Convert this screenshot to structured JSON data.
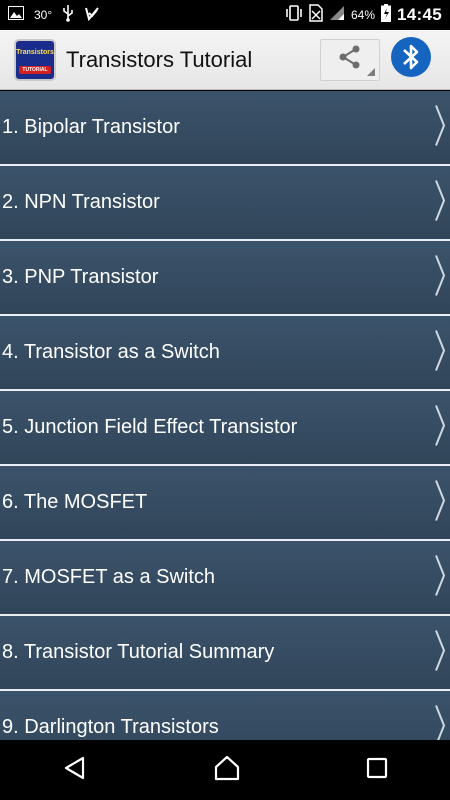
{
  "status_bar": {
    "temperature": "30°",
    "battery_percent": "64%",
    "time": "14:45",
    "icons": [
      "gallery-icon",
      "usb-icon",
      "checkbox-notify-icon",
      "vibrate-icon",
      "no-sim-icon",
      "signal-icon",
      "battery-icon"
    ]
  },
  "app_bar": {
    "title": "Transistors Tutorial",
    "icon_text_top": "Transistors",
    "icon_text_bottom": "TUTORIAL",
    "accent": "#1565c0"
  },
  "list": {
    "items": [
      {
        "label": "1. Bipolar Transistor"
      },
      {
        "label": "2. NPN Transistor"
      },
      {
        "label": "3. PNP Transistor"
      },
      {
        "label": "4. Transistor as a Switch"
      },
      {
        "label": "5. Junction Field Effect Transistor"
      },
      {
        "label": "6. The MOSFET"
      },
      {
        "label": "7. MOSFET as a Switch"
      },
      {
        "label": "8. Transistor Tutorial Summary"
      },
      {
        "label": "9. Darlington Transistors"
      }
    ]
  },
  "colors": {
    "list_background": "#34495e",
    "divider": "#e8eef3",
    "text": "#ffffff"
  }
}
